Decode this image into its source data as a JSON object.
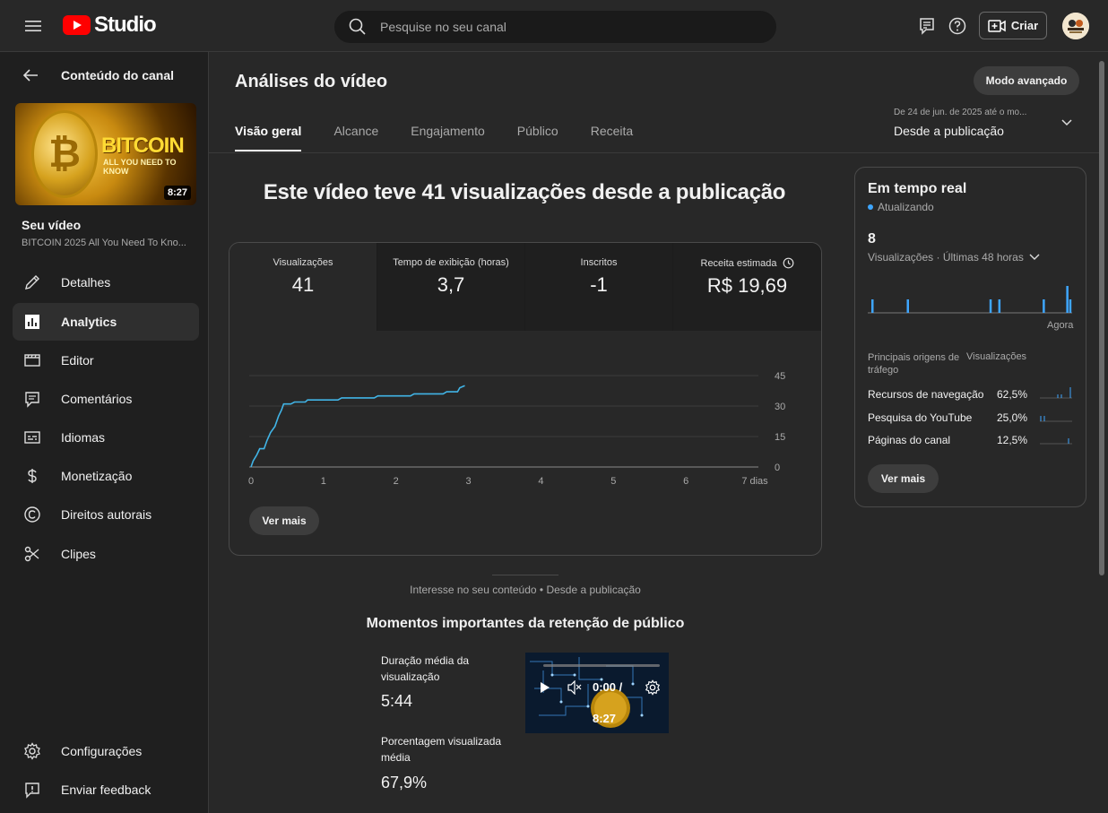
{
  "app": {
    "logo_text": "Studio"
  },
  "search": {
    "placeholder": "Pesquise no seu canal"
  },
  "header": {
    "create_label": "Criar"
  },
  "sidebar": {
    "back_label": "Conteúdo do canal",
    "thumbnail": {
      "title": "BITCOIN",
      "subtitle": "ALL YOU NEED TO KNOW",
      "duration": "8:27"
    },
    "your_video_label": "Seu vídeo",
    "video_title": "BITCOIN 2025 All You Need To Kno...",
    "items": [
      {
        "label": "Detalhes",
        "icon": "pencil-icon"
      },
      {
        "label": "Analytics",
        "icon": "analytics-icon",
        "active": true
      },
      {
        "label": "Editor",
        "icon": "clapper-icon"
      },
      {
        "label": "Comentários",
        "icon": "comment-icon"
      },
      {
        "label": "Idiomas",
        "icon": "subtitles-icon"
      },
      {
        "label": "Monetização",
        "icon": "dollar-icon"
      },
      {
        "label": "Direitos autorais",
        "icon": "copyright-icon"
      },
      {
        "label": "Clipes",
        "icon": "scissors-icon"
      }
    ],
    "bottom_items": [
      {
        "label": "Configurações",
        "icon": "gear-icon"
      },
      {
        "label": "Enviar feedback",
        "icon": "feedback-icon"
      }
    ]
  },
  "main": {
    "title": "Análises do vídeo",
    "advanced_mode": "Modo avançado",
    "tabs": [
      "Visão geral",
      "Alcance",
      "Engajamento",
      "Público",
      "Receita"
    ],
    "active_tab": 0,
    "date_range": {
      "detail": "De 24 de jun. de 2025 até o mo...",
      "label": "Desde a publicação"
    },
    "headline": "Este vídeo teve 41 visualizações desde a publicação",
    "metrics": [
      {
        "label": "Visualizações",
        "value": "41"
      },
      {
        "label": "Tempo de exibição (horas)",
        "value": "3,7"
      },
      {
        "label": "Inscritos",
        "value": "-1"
      },
      {
        "label": "Receita estimada",
        "value": "R$ 19,69"
      }
    ],
    "see_more": "Ver mais",
    "interest_label": "Interesse no seu conteúdo • Desde a publicação",
    "retention_title": "Momentos importantes da retenção de público",
    "avg_duration_label": "Duração média da visualização",
    "avg_duration_value": "5:44",
    "avg_percent_label": "Porcentagem visualizada média",
    "avg_percent_value": "67,9%",
    "player": {
      "time": "0:00 /",
      "duration": "8:27"
    }
  },
  "chart_data": {
    "type": "line",
    "x_tick_labels": [
      "0",
      "1",
      "2",
      "3",
      "4",
      "5",
      "6",
      "7 dias"
    ],
    "y_tick_labels": [
      "45",
      "30",
      "15",
      "0"
    ],
    "xlim": [
      0,
      7
    ],
    "ylim": [
      0,
      45
    ],
    "series": [
      {
        "color": "#41b4e6",
        "points": [
          [
            0,
            0
          ],
          [
            0.03,
            3
          ],
          [
            0.08,
            6
          ],
          [
            0.12,
            9
          ],
          [
            0.18,
            9
          ],
          [
            0.22,
            13
          ],
          [
            0.27,
            17
          ],
          [
            0.33,
            20
          ],
          [
            0.38,
            25
          ],
          [
            0.42,
            28
          ],
          [
            0.45,
            31
          ],
          [
            0.55,
            31
          ],
          [
            0.6,
            32
          ],
          [
            0.75,
            32
          ],
          [
            0.78,
            33
          ],
          [
            1.2,
            33
          ],
          [
            1.25,
            34
          ],
          [
            1.7,
            34
          ],
          [
            1.75,
            35
          ],
          [
            2.2,
            35
          ],
          [
            2.25,
            36
          ],
          [
            2.65,
            36
          ],
          [
            2.7,
            37
          ],
          [
            2.85,
            37
          ],
          [
            2.88,
            39
          ],
          [
            2.95,
            40
          ]
        ]
      }
    ]
  },
  "realtime": {
    "title": "Em tempo real",
    "status": "Atualizando",
    "count": "8",
    "period": "Visualizações · Últimas 48 horas",
    "now_label": "Agora",
    "header_source": "Principais origens de tráfego",
    "header_views": "Visualizações",
    "sources": [
      {
        "name": "Recursos de navegação",
        "percent": "62,5%"
      },
      {
        "name": "Pesquisa do YouTube",
        "percent": "25,0%"
      },
      {
        "name": "Páginas do canal",
        "percent": "12,5%"
      }
    ],
    "see_more": "Ver mais",
    "bars": [
      1,
      0,
      0,
      0,
      0,
      0,
      0,
      0,
      0,
      0,
      0,
      0,
      1,
      0,
      0,
      0,
      0,
      0,
      0,
      0,
      0,
      0,
      0,
      0,
      0,
      0,
      0,
      0,
      0,
      0,
      0,
      0,
      0,
      0,
      0,
      0,
      0,
      0,
      0,
      0,
      1,
      0,
      0,
      1,
      0,
      0,
      0,
      0,
      0,
      0,
      0,
      0,
      0,
      0,
      0,
      0,
      0,
      0,
      1,
      0,
      0,
      0,
      0,
      0,
      0,
      0,
      2,
      1
    ],
    "accent": "#3ea6ff"
  },
  "colors": {
    "brand": "#ff0000",
    "accent": "#3ea6ff"
  }
}
